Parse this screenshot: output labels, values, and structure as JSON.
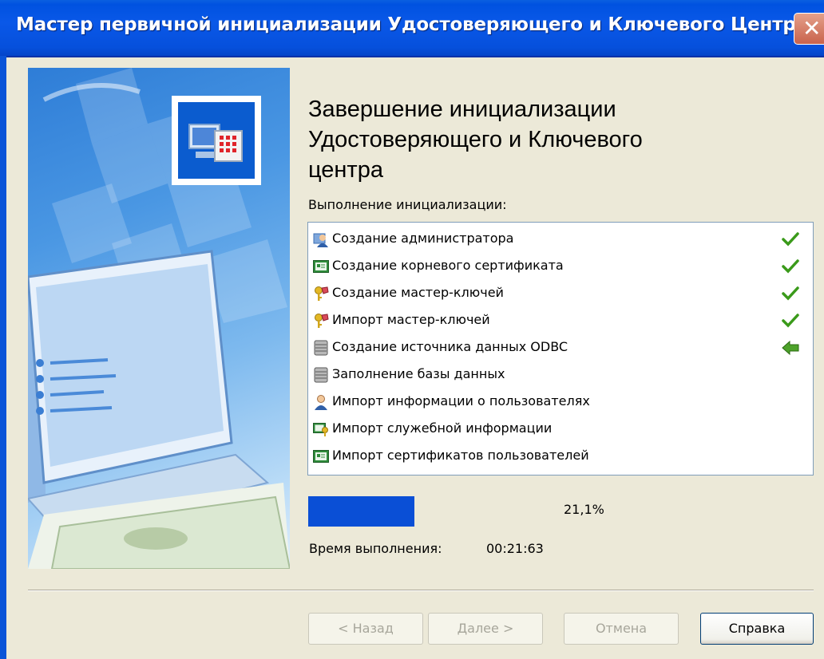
{
  "window": {
    "title": "Мастер первичной инициализации Удостоверяющего и Ключевого Центра",
    "close_glyph": "✕"
  },
  "heading": {
    "line1": "Завершение инициализации",
    "line2": "Удостоверяющего и Ключевого",
    "line3": "центра"
  },
  "steps_label": "Выполнение инициализации:",
  "steps": [
    {
      "label": "Создание администратора",
      "icon": "admin-user-icon",
      "status": "done"
    },
    {
      "label": "Создание корневого сертификата",
      "icon": "certificate-icon",
      "status": "done"
    },
    {
      "label": "Создание мастер-ключей",
      "icon": "keys-icon",
      "status": "done"
    },
    {
      "label": "Импорт мастер-ключей",
      "icon": "keys-icon",
      "status": "done"
    },
    {
      "label": "Создание источника данных ODBC",
      "icon": "database-icon",
      "status": "in-progress"
    },
    {
      "label": "Заполнение базы данных",
      "icon": "database-icon",
      "status": "pending"
    },
    {
      "label": "Импорт информации о пользователях",
      "icon": "user-icon",
      "status": "pending"
    },
    {
      "label": "Импорт служебной информации",
      "icon": "certificate-key-icon",
      "status": "pending"
    },
    {
      "label": "Импорт сертификатов пользователей",
      "icon": "certificate-icon",
      "status": "pending"
    }
  ],
  "progress": {
    "text": "21,1%",
    "fraction": 0.211
  },
  "elapsed": {
    "label": "Время выполнения:",
    "value": "00:21:63"
  },
  "buttons": {
    "back": "< Назад",
    "next": "Далее >",
    "cancel": "Отмена",
    "help": "Справка"
  },
  "colors": {
    "accent": "#0a4fd6",
    "done": "#3a9a1a",
    "in_progress": "#3a8a1a"
  }
}
